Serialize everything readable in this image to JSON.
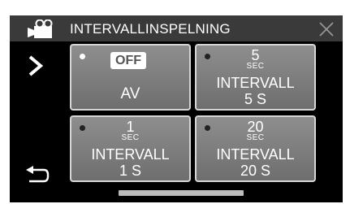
{
  "header": {
    "title": "INTERVALLINSPELNING",
    "mode_icon": "video-camera-icon",
    "close_icon": "close-icon"
  },
  "nav": {
    "next_icon": "chevron-right-icon",
    "back_icon": "return-icon"
  },
  "options": [
    {
      "id": "off",
      "badge": "OFF",
      "label": "AV",
      "selected": true
    },
    {
      "id": "5s",
      "number": "5",
      "unit": "SEC",
      "line1": "INTERVALL",
      "line2": "5 S",
      "selected": false
    },
    {
      "id": "1s",
      "number": "1",
      "unit": "SEC",
      "line1": "INTERVALL",
      "line2": "1 S",
      "selected": false
    },
    {
      "id": "20s",
      "number": "20",
      "unit": "SEC",
      "line1": "INTERVALL",
      "line2": "20 S",
      "selected": false
    }
  ],
  "colors": {
    "background": "#000000",
    "header": "#3a3a3a",
    "tile": "#7e7e7e",
    "tile_border": "#d6d6d6",
    "text": "#ffffff"
  }
}
